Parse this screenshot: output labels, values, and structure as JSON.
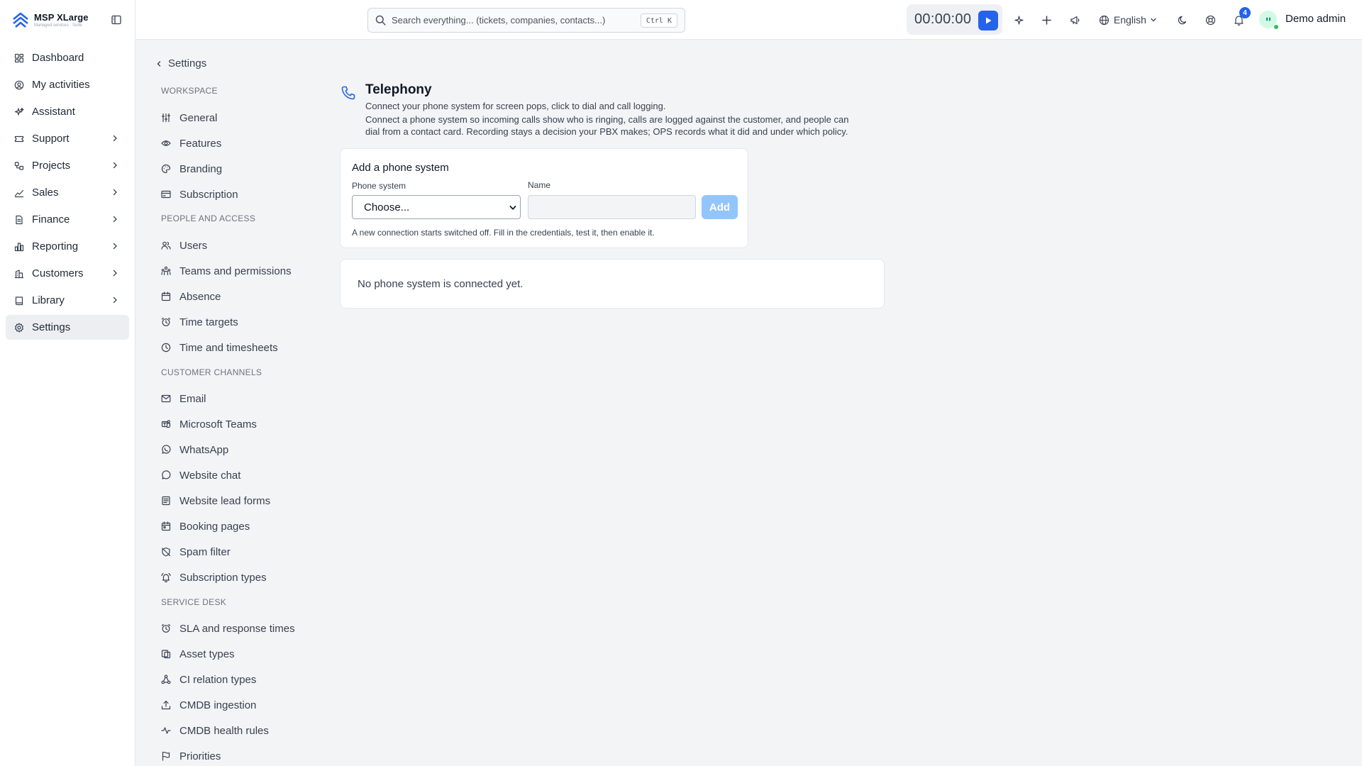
{
  "brand": {
    "name": "MSP XLarge",
    "subtitle": "Managed services · Suite"
  },
  "nav": [
    {
      "label": "Dashboard",
      "icon": "dashboard-icon",
      "chevron": false,
      "active": false
    },
    {
      "label": "My activities",
      "icon": "user-circle-icon",
      "chevron": false,
      "active": false
    },
    {
      "label": "Assistant",
      "icon": "sparkles-icon",
      "chevron": false,
      "active": false
    },
    {
      "label": "Support",
      "icon": "ticket-icon",
      "chevron": true,
      "active": false
    },
    {
      "label": "Projects",
      "icon": "projects-icon",
      "chevron": true,
      "active": false
    },
    {
      "label": "Sales",
      "icon": "trend-icon",
      "chevron": true,
      "active": false
    },
    {
      "label": "Finance",
      "icon": "document-icon",
      "chevron": true,
      "active": false
    },
    {
      "label": "Reporting",
      "icon": "bar-chart-icon",
      "chevron": true,
      "active": false
    },
    {
      "label": "Customers",
      "icon": "building-icon",
      "chevron": true,
      "active": false
    },
    {
      "label": "Library",
      "icon": "book-icon",
      "chevron": true,
      "active": false
    },
    {
      "label": "Settings",
      "icon": "gear-icon",
      "chevron": false,
      "active": true
    }
  ],
  "topbar": {
    "search_placeholder": "Search everything... (tickets, companies, contacts...)",
    "shortcut": "Ctrl K",
    "timer": "00:00:00",
    "language": "English",
    "notification_count": "4",
    "user_name": "Demo admin"
  },
  "subnav": {
    "back_label": "Settings",
    "sections": [
      {
        "title": "WORKSPACE",
        "items": [
          {
            "label": "General",
            "icon": "sliders-icon"
          },
          {
            "label": "Features",
            "icon": "eye-icon"
          },
          {
            "label": "Branding",
            "icon": "palette-icon"
          },
          {
            "label": "Subscription",
            "icon": "credit-card-icon"
          }
        ]
      },
      {
        "title": "PEOPLE AND ACCESS",
        "items": [
          {
            "label": "Users",
            "icon": "users-icon"
          },
          {
            "label": "Teams and permissions",
            "icon": "team-icon"
          },
          {
            "label": "Absence",
            "icon": "calendar-icon"
          },
          {
            "label": "Time targets",
            "icon": "alarm-clock-icon"
          },
          {
            "label": "Time and timesheets",
            "icon": "clock-icon"
          }
        ]
      },
      {
        "title": "CUSTOMER CHANNELS",
        "items": [
          {
            "label": "Email",
            "icon": "mail-icon"
          },
          {
            "label": "Microsoft Teams",
            "icon": "teams-icon"
          },
          {
            "label": "WhatsApp",
            "icon": "whatsapp-icon"
          },
          {
            "label": "Website chat",
            "icon": "chat-bubble-icon"
          },
          {
            "label": "Website lead forms",
            "icon": "form-icon"
          },
          {
            "label": "Booking pages",
            "icon": "calendar-check-icon"
          },
          {
            "label": "Spam filter",
            "icon": "shield-off-icon"
          },
          {
            "label": "Subscription types",
            "icon": "bell-ring-icon"
          }
        ]
      },
      {
        "title": "SERVICE DESK",
        "items": [
          {
            "label": "SLA and response times",
            "icon": "alarm-clock-icon"
          },
          {
            "label": "Asset types",
            "icon": "asset-icon"
          },
          {
            "label": "CI relation types",
            "icon": "relation-icon"
          },
          {
            "label": "CMDB ingestion",
            "icon": "upload-icon"
          },
          {
            "label": "CMDB health rules",
            "icon": "activity-icon"
          },
          {
            "label": "Priorities",
            "icon": "flag-icon"
          }
        ]
      }
    ]
  },
  "main": {
    "title": "Telephony",
    "subtitle": "Connect your phone system for screen pops, click to dial and call logging.",
    "description": "Connect a phone system so incoming calls show who is ringing, calls are logged against the customer, and people can dial from a contact card. Recording stays a decision your PBX makes; OPS records what it did and under which policy.",
    "add_card": {
      "title": "Add a phone system",
      "phone_label": "Phone system",
      "phone_value": "Choose...",
      "name_label": "Name",
      "name_value": "",
      "add_label": "Add",
      "hint": "A new connection starts switched off. Fill in the credentials, test it, then enable it."
    },
    "empty_text": "No phone system is connected yet."
  },
  "colors": {
    "accent": "#2563eb",
    "add_disabled": "#93c5fd",
    "status_online": "#22c55e"
  }
}
